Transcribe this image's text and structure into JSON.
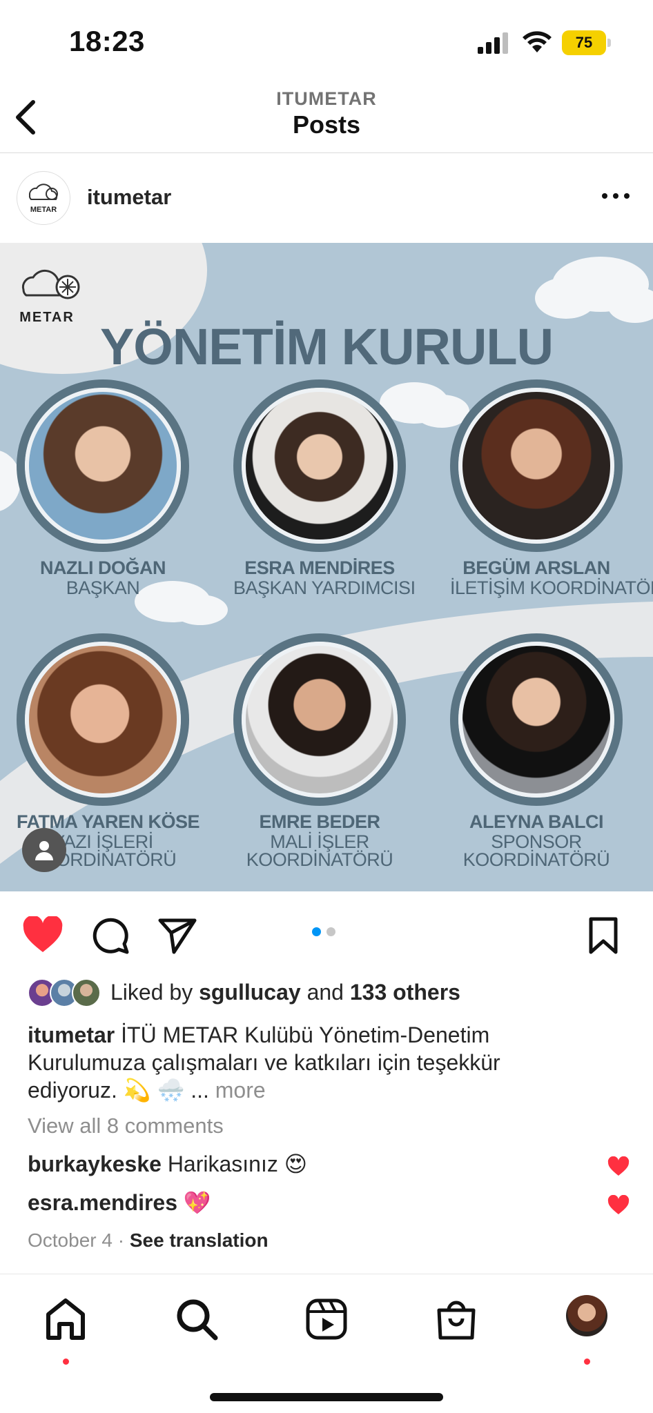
{
  "status_bar": {
    "time": "18:23",
    "battery": "75"
  },
  "nav": {
    "subtitle": "ITUMETAR",
    "title": "Posts"
  },
  "post": {
    "username": "itumetar",
    "image": {
      "headline": "YÖNETİM KURULU",
      "members": [
        {
          "name": "NAZLI DOĞAN",
          "role": [
            "BAŞKAN"
          ]
        },
        {
          "name": "ESRA MENDİRES",
          "role": [
            "BAŞKAN YARDIMCISI"
          ]
        },
        {
          "name": "BEGÜM ARSLAN",
          "role": [
            "İLETİŞİM KOORDİNATÖRÜ"
          ]
        },
        {
          "name": "FATMA YAREN KÖSE",
          "role": [
            "YAZI İŞLERİ",
            "KOORDİNATÖRÜ"
          ]
        },
        {
          "name": "EMRE BEDER",
          "role": [
            "MALİ İŞLER",
            "KOORDİNATÖRÜ"
          ]
        },
        {
          "name": "ALEYNA BALCI",
          "role": [
            "SPONSOR",
            "KOORDİNATÖRÜ"
          ]
        }
      ]
    },
    "liked_by_prefix": "Liked by",
    "liked_by_user": "sgullucay",
    "liked_by_and": "and",
    "liked_by_others": "133 others",
    "caption_user": "itumetar",
    "caption_text": "İTÜ METAR Kulübü Yönetim-Denetim Kurulumuza çalışmaları ve katkıları için teşekkür ediyoruz. 💫 🌨️ ...",
    "caption_more": "more",
    "view_comments": "View all 8 comments",
    "comments": [
      {
        "user": "burkaykeske",
        "text": "Harikasınız 😍"
      },
      {
        "user": "esra.mendires",
        "text": "💖"
      }
    ],
    "date": "October 4",
    "see_translation": "See translation"
  },
  "colors": {
    "like_red": "#ff3040",
    "carousel_active": "#0095f6",
    "battery_yellow": "#f5d000"
  },
  "icons": {
    "back": "chevron-left-icon",
    "more": "more-horizontal-icon",
    "like": "heart-filled-icon",
    "comment": "comment-icon",
    "share": "paper-plane-icon",
    "save": "bookmark-icon",
    "home": "home-icon",
    "search": "search-icon",
    "reels": "reels-icon",
    "shop": "shop-bag-icon"
  }
}
